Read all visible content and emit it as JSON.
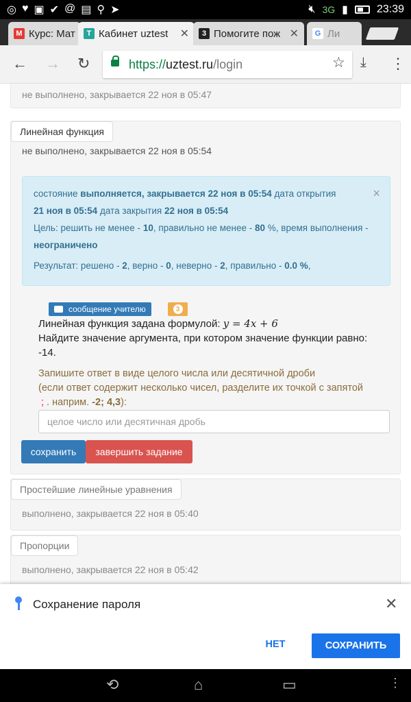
{
  "status_bar": {
    "left_icons": [
      "chrome-icon",
      "heart-icon",
      "image-icon",
      "check-icon",
      "at-icon",
      "chat-icon",
      "search-icon",
      "send-icon"
    ],
    "network": "3G",
    "time": "23:39"
  },
  "tabs": [
    {
      "label": "Курс: Мат",
      "icon": "mkr-icon",
      "color": "#e53935",
      "letter": "M"
    },
    {
      "label": "Кабинет uztest",
      "icon": "uztest-icon",
      "color": "#26a69a",
      "letter": "T"
    },
    {
      "label": "Помогите пож",
      "icon": "znanija-icon",
      "color": "#222222",
      "letter": "3"
    },
    {
      "label": "Ли",
      "icon": "google-icon",
      "color": "#4285f4",
      "letter": "G"
    }
  ],
  "omnibox": {
    "scheme": "https://",
    "host": "uztest.ru",
    "path": "/login"
  },
  "cards": {
    "previous": {
      "status": "не выполнено, закрывается 22 ноя в 05:47"
    },
    "current": {
      "title": "Линейная функция",
      "status": "не выполнено, закрывается 22 ноя в 05:54"
    },
    "simple_eq": {
      "title": "Простейшие линейные уравнения",
      "status": "выполнено, закрывается 22 ноя в 05:40"
    },
    "proportions": {
      "title": "Пропорции",
      "status": "выполнено, закрывается 22 ноя в 05:42"
    }
  },
  "alert": {
    "state_label": "состояние",
    "state_value": "выполняется, закрывается 22 ноя в 05:54",
    "open_label": "дата открытия",
    "open_value": "21 ноя в 05:54",
    "close_label": "дата закрытия",
    "close_value": "22 ноя в 05:54",
    "goal_prefix": "Цель: решить не менее -",
    "goal_count": "10",
    "goal_mid": ", правильно не менее -",
    "goal_percent": "80",
    "goal_tail": "%, время выполнения -",
    "goal_time": "неограничено",
    "result_prefix": "Результат: решено -",
    "solved": "2",
    "correct_label": ", верно -",
    "correct": "0",
    "wrong_label": ", неверно -",
    "wrong": "2",
    "percent_label": ", правильно -",
    "percent": "0.0 %",
    "result_tail": ","
  },
  "message_button": "сообщение  учителю",
  "message_count": "3",
  "task": {
    "line1_text": "Линейная функция задана формулой:",
    "formula": "y = 4x + 6",
    "line2": "Найдите значение аргумента, при котором значение функции равно:",
    "line3": "-14."
  },
  "hint": {
    "line1": "Запишите ответ в виде целого числа или десятичной дроби",
    "line2": "(если ответ содержит несколько чисел, разделите их точкой с запятой",
    "separator": ";",
    "example_prefix": ". наприм.",
    "example": "-2; 4,3",
    "tail": "):"
  },
  "answer": {
    "value": "",
    "placeholder": "целое число или десятичная дробь"
  },
  "buttons": {
    "save": "сохранить",
    "finish": "завершить задание"
  },
  "password_prompt": {
    "title": "Сохранение пароля",
    "no": "НЕТ",
    "yes": "СОХРАНИТЬ"
  },
  "colors": {
    "primary": "#337ab7",
    "danger": "#d9534f",
    "warning": "#f0ad4e",
    "info_bg": "#d9edf7",
    "chrome_blue": "#1a73e8"
  }
}
